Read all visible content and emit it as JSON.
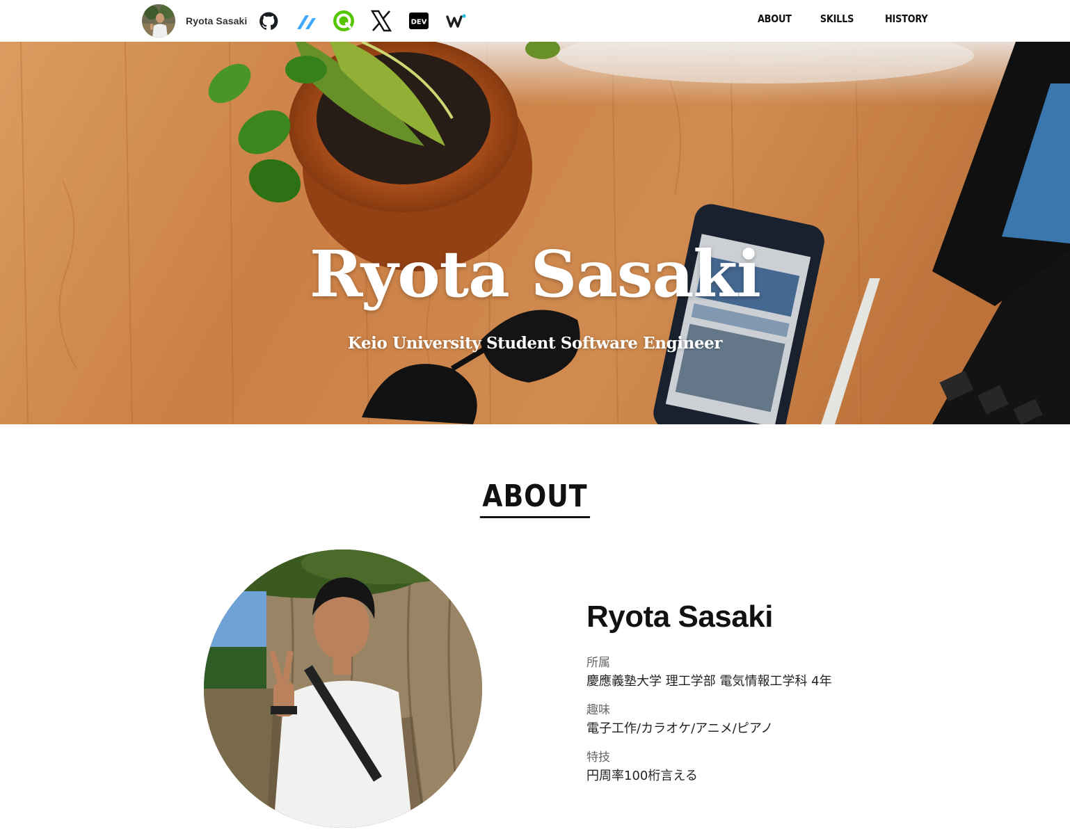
{
  "navbar": {
    "brand_name": "Ryota Sasaki",
    "social_icons": [
      "github-icon",
      "zenn-icon",
      "qiita-icon",
      "x-icon",
      "dev-icon",
      "wantedly-icon"
    ],
    "dev_badge_text": "DEV",
    "links": [
      "ABOUT",
      "SKILLS",
      "HISTORY"
    ]
  },
  "hero": {
    "title": "Ryota Sasaki",
    "subtitle": "Keio University Student Software Engineer"
  },
  "about": {
    "section_title": "ABOUT",
    "name": "Ryota Sasaki",
    "items": [
      {
        "label": "所属",
        "value": "慶應義塾大学 理工学部 電気情報工学科 4年"
      },
      {
        "label": "趣味",
        "value": "電子工作/カラオケ/アニメ/ピアノ"
      },
      {
        "label": "特技",
        "value": "円周率100桁言える"
      }
    ]
  },
  "colors": {
    "qiita_green": "#55c500",
    "zenn_blue": "#3ea8ff",
    "text_dark": "#111111",
    "wood": "#d9894a"
  }
}
